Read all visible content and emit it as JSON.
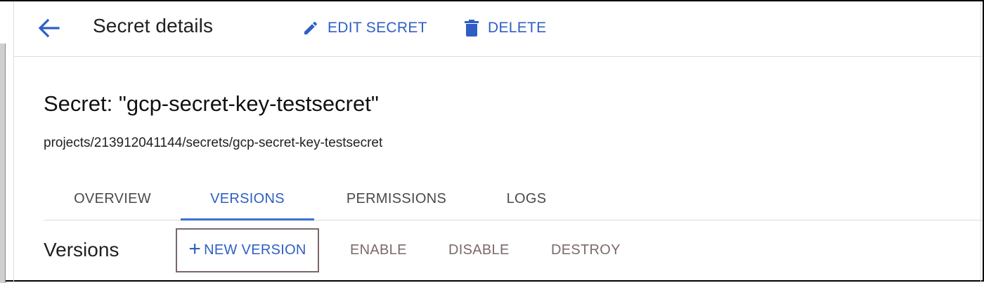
{
  "header": {
    "title": "Secret details",
    "edit_label": "EDIT SECRET",
    "delete_label": "DELETE"
  },
  "secret": {
    "title": "Secret: \"gcp-secret-key-testsecret\"",
    "path": "projects/213912041144/secrets/gcp-secret-key-testsecret"
  },
  "tabs": [
    {
      "label": "OVERVIEW",
      "active": false
    },
    {
      "label": "VERSIONS",
      "active": true
    },
    {
      "label": "PERMISSIONS",
      "active": false
    },
    {
      "label": "LOGS",
      "active": false
    }
  ],
  "versions": {
    "heading": "Versions",
    "new_version_label": "NEW VERSION",
    "enable_label": "ENABLE",
    "disable_label": "DISABLE",
    "destroy_label": "DESTROY"
  },
  "icons": {
    "back": "arrow-back-icon",
    "edit": "pencil-icon",
    "delete": "trash-icon",
    "add": "plus-icon"
  },
  "colors": {
    "accent": "#2f5fc4",
    "text_primary": "#202124",
    "divider": "#dadce0",
    "disabled_action": "#7a6a6a"
  }
}
